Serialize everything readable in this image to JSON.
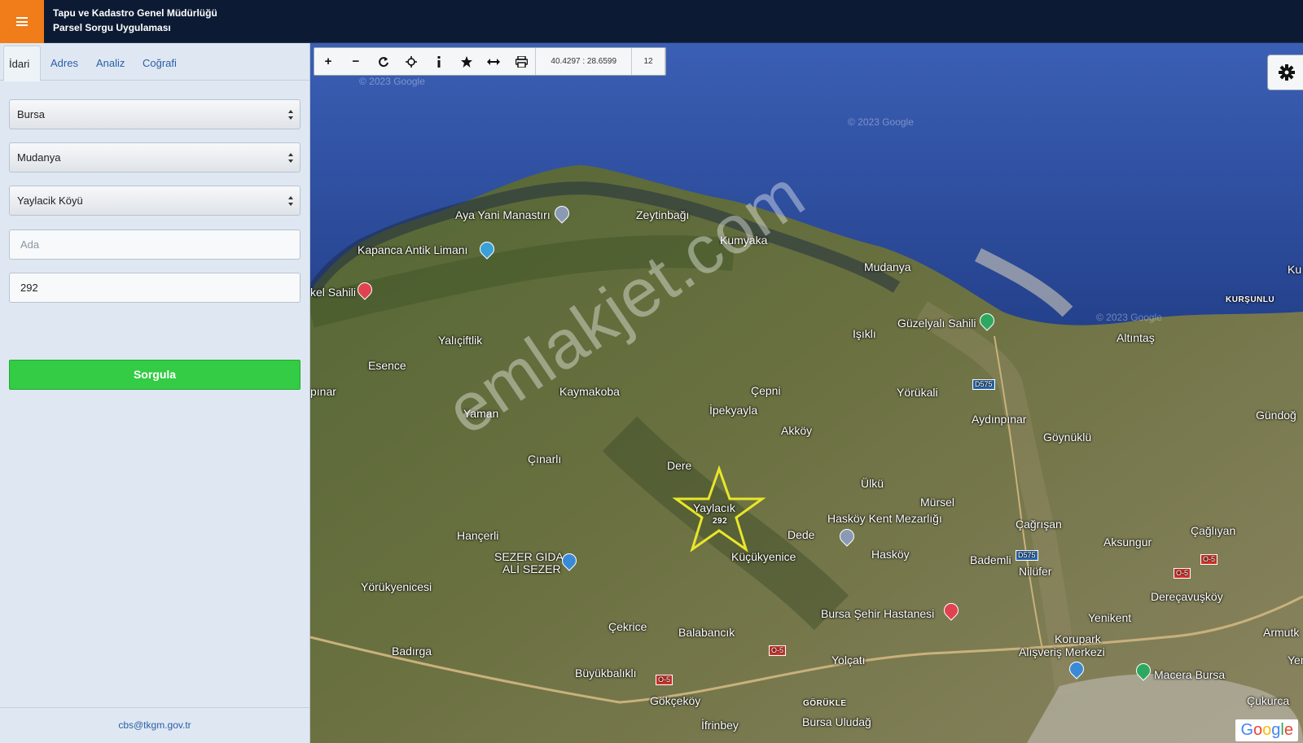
{
  "header": {
    "title_line1": "Tapu ve Kadastro Genel Müdürlüğü",
    "title_line2": "Parsel Sorgu Uygulaması"
  },
  "sidebar": {
    "tabs": [
      "İdari",
      "Adres",
      "Analiz",
      "Coğrafi"
    ],
    "active_tab": "İdari",
    "province": "Bursa",
    "district": "Mudanya",
    "village": "Yaylacik Köyü",
    "ada_placeholder": "Ada",
    "parsel_value": "292",
    "query_button": "Sorgula",
    "footer_email": "cbs@tkgm.gov.tr"
  },
  "toolbar": {
    "zoom_in": "+",
    "zoom_out": "−",
    "coordinates": "40.4297 : 28.6599",
    "zoom_level": "12"
  },
  "map": {
    "watermark": "emlakjet.com",
    "copyright": "© 2023 Google",
    "google_watermark": "Google",
    "marker_label": "Yaylacık",
    "marker_parcel": "292",
    "labels": {
      "aya_yani": "Aya Yani Manastırı",
      "zeytinbagi": "Zeytinbağı",
      "kumyaka": "Kumyaka",
      "kapanca": "Kapanca Antik Limanı",
      "kel_sahili": "kel Sahili",
      "mudanya": "Mudanya",
      "ku": "Ku",
      "kursunlu": "KURŞUNLU",
      "guzelyali": "Güzelyalı Sahili",
      "altintas": "Altıntaş",
      "isikli": "Işıklı",
      "yalicitlik": "Yalıçiftlik",
      "esence": "Esence",
      "pinar": "pınar",
      "kaymakoba": "Kaymakoba",
      "cepni": "Çepni",
      "yorukali": "Yörükali",
      "aydinpinar": "Aydınpınar",
      "gundog": "Gündoğ",
      "ipekyayla": "İpekyayla",
      "akkoy": "Akköy",
      "yaman": "Yaman",
      "goynuklu": "Göynüklü",
      "cinarli": "Çınarlı",
      "dere": "Dere",
      "ulku": "Ülkü",
      "mursel": "Mürsel",
      "haskoy_mezar": "Hasköy Kent Mezarlığı",
      "cagrisan": "Çağrışan",
      "cagliyan": "Çağlıyan",
      "dede": "Dede",
      "akcsungur": "Aksungur",
      "hanceri": "Hançerli",
      "sezer1": "SEZER GIDA",
      "sezer2": "ALİ SEZER",
      "kucukyenice": "Küçükyenice",
      "haskoy": "Hasköy",
      "bademli": "Bademli",
      "nilufer": "Nilüfer",
      "yorukenicesi": "Yörükyenicesi",
      "derecavuskoy": "Dereçavuşköy",
      "hastane": "Bursa Şehir Hastanesi",
      "yenikent": "Yenikent",
      "cekrice": "Çekrice",
      "balabancik": "Balabancık",
      "armutk": "Armutk",
      "badirga": "Badırga",
      "korupark1": "Korupark",
      "korupark2": "Alışveriş Merkezi",
      "yolcati": "Yolçatı",
      "yeni": "Yeni",
      "buyukbalikli": "Büyükbalıklı",
      "macera": "Macera Bursa",
      "gokcekoy": "Gökçeköy",
      "gorukle": "GÖRÜKLE",
      "uludag": "Bursa Uludağ",
      "ifrrbey": "İfrinbey",
      "cukurca": "Çukurca"
    },
    "roads": [
      "D575",
      "D575",
      "O-5",
      "O-5",
      "O-5",
      "O-5"
    ]
  }
}
